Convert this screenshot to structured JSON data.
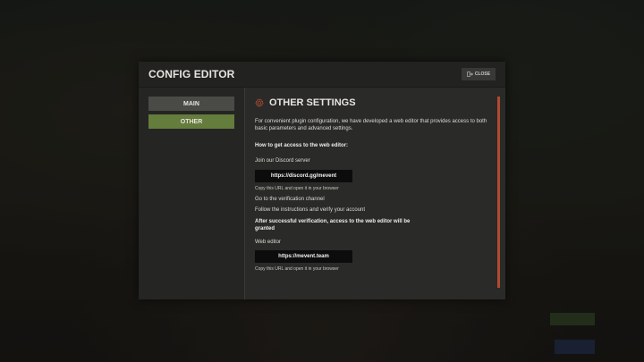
{
  "window": {
    "title": "CONFIG EDITOR",
    "close_label": "CLOSE"
  },
  "sidebar": {
    "tabs": [
      {
        "label": "MAIN",
        "active": false
      },
      {
        "label": "OTHER",
        "active": true
      }
    ]
  },
  "content": {
    "heading": "OTHER SETTINGS",
    "intro": "For convenient plugin configuration, we have developed a web editor that provides access to both basic parameters and advanced settings.",
    "howto": "How to get access to the web editor:",
    "step_discord": "Join our Discord server",
    "discord_url": "https://discord.gg/mevent",
    "hint_discord": "Copy this URL and open it in your browser",
    "step_verify_channel": "Go to the verification channel",
    "step_follow": "Follow the instructions and verify your account",
    "granted": "After successful verification, access to the web editor will be granted",
    "web_editor_label": "Web editor",
    "web_editor_url": "https://mevent.team",
    "hint_web": "Copy this URL and open it in your browser"
  },
  "colors": {
    "active_tab": "#647c3c",
    "inactive_tab": "#4a4a47",
    "accent": "#b04a30"
  },
  "icons": {
    "heading": "gear-icon",
    "close": "exit-door-icon"
  }
}
